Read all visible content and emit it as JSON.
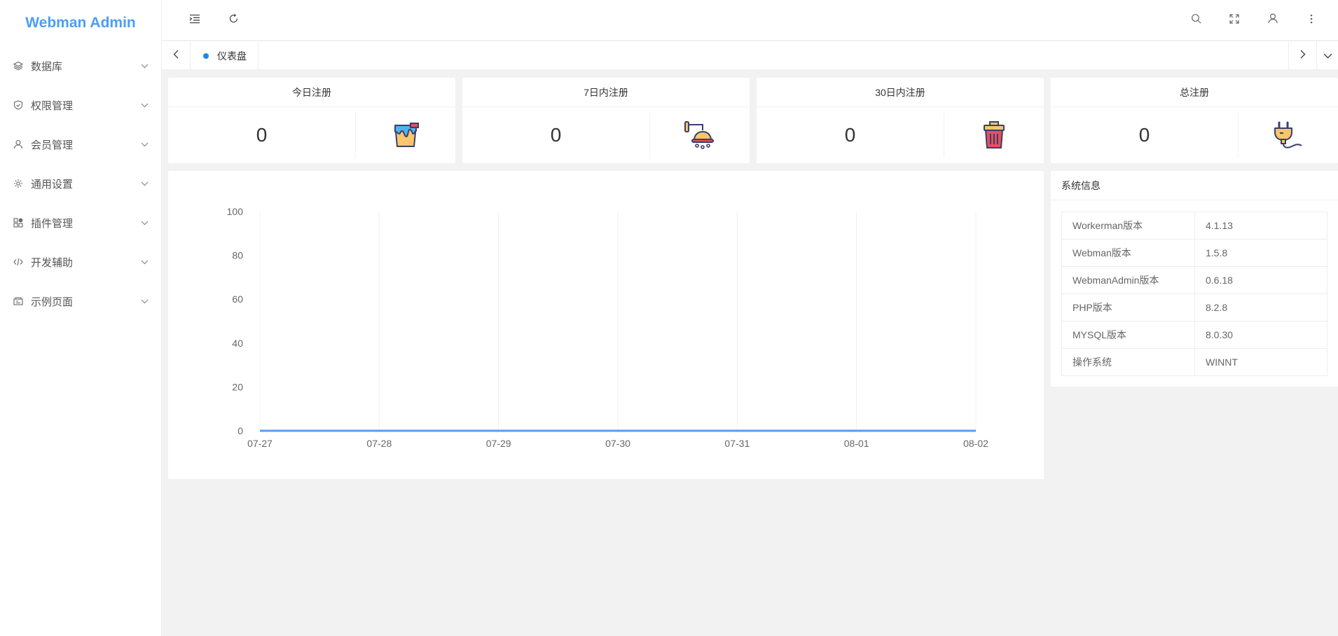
{
  "app": {
    "title": "Webman Admin"
  },
  "sidebar": {
    "items": [
      {
        "label": "数据库",
        "icon": "layers-icon"
      },
      {
        "label": "权限管理",
        "icon": "shield-icon"
      },
      {
        "label": "会员管理",
        "icon": "user-icon"
      },
      {
        "label": "通用设置",
        "icon": "gear-icon"
      },
      {
        "label": "插件管理",
        "icon": "plugin-icon"
      },
      {
        "label": "开发辅助",
        "icon": "code-icon"
      },
      {
        "label": "示例页面",
        "icon": "template-icon"
      }
    ]
  },
  "header": {
    "left_icons": [
      "menu-fold-icon",
      "refresh-icon"
    ],
    "right_icons": [
      "search-icon",
      "fullscreen-icon",
      "user-icon",
      "more-icon"
    ]
  },
  "tabs": [
    {
      "label": "仪表盘",
      "active": true
    }
  ],
  "stats": [
    {
      "title": "今日注册",
      "value": "0",
      "icon": "paint-bucket-icon"
    },
    {
      "title": "7日内注册",
      "value": "0",
      "icon": "shower-icon"
    },
    {
      "title": "30日内注册",
      "value": "0",
      "icon": "trash-can-icon"
    },
    {
      "title": "总注册",
      "value": "0",
      "icon": "power-plug-icon"
    }
  ],
  "chart_data": {
    "type": "line",
    "x": [
      "07-27",
      "07-28",
      "07-29",
      "07-30",
      "07-31",
      "08-01",
      "08-02"
    ],
    "series": [
      {
        "values": [
          0,
          0,
          0,
          0,
          0,
          0,
          0
        ]
      }
    ],
    "ylim": [
      0,
      100
    ],
    "yticks": [
      0,
      20,
      40,
      60,
      80,
      100
    ],
    "grid": "vertical",
    "color": "#5b9bf0"
  },
  "system_info": {
    "title": "系统信息",
    "rows": [
      {
        "label": "Workerman版本",
        "value": "4.1.13"
      },
      {
        "label": "Webman版本",
        "value": "1.5.8"
      },
      {
        "label": "WebmanAdmin版本",
        "value": "0.6.18"
      },
      {
        "label": "PHP版本",
        "value": "8.2.8"
      },
      {
        "label": "MYSQL版本",
        "value": "8.0.30"
      },
      {
        "label": "操作系统",
        "value": "WINNT"
      }
    ]
  },
  "colors": {
    "brand": "#4a9ff5",
    "accent": "#1e88e5",
    "background": "#f2f2f2"
  }
}
